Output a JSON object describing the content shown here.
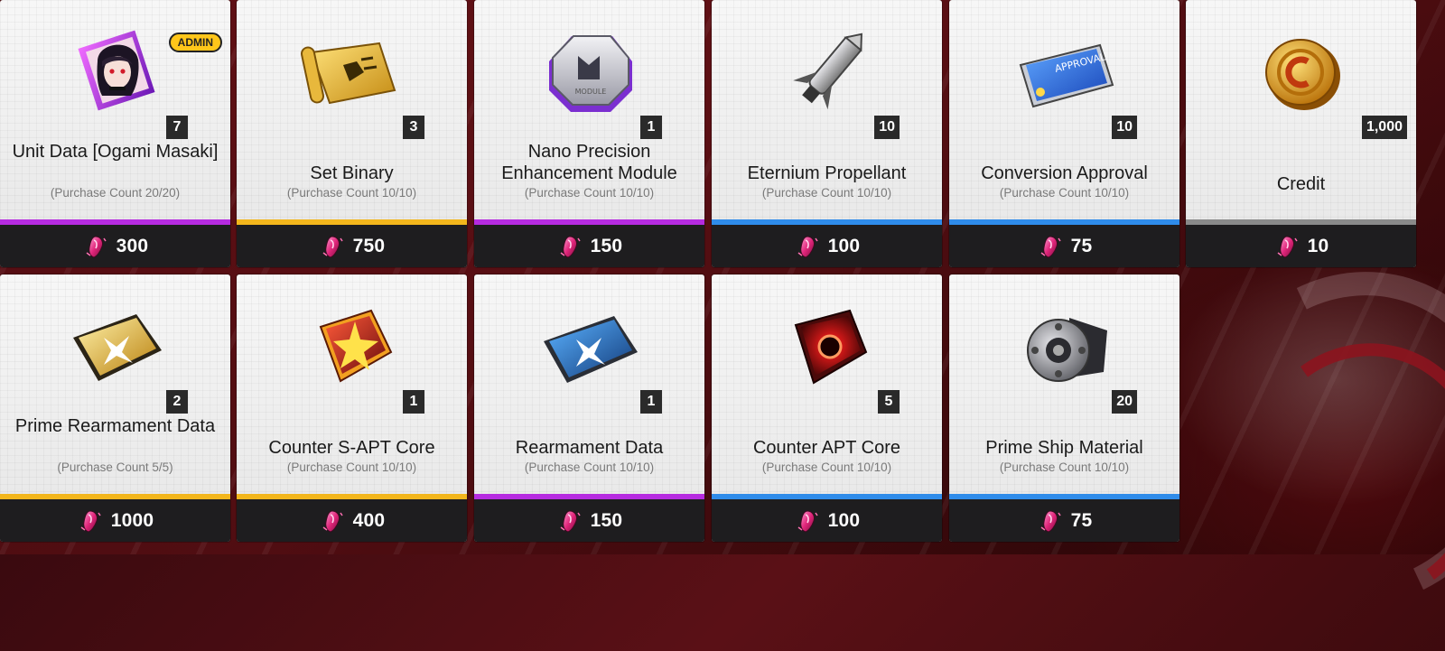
{
  "colors": {
    "purple": "#b62be0",
    "gold": "#f3b61c",
    "blue": "#2f8cea",
    "gray": "#8a8a8a"
  },
  "items": [
    {
      "name": "Unit Data [Ogami Masaki]",
      "count": "(Purchase Count 20/20)",
      "qty": "7",
      "price": "300",
      "rarity": "purple",
      "badge": "ADMIN",
      "icon": "unit-portrait-icon"
    },
    {
      "name": "Set Binary",
      "count": "(Purchase Count 10/10)",
      "qty": "3",
      "price": "750",
      "rarity": "gold",
      "icon": "scroll-icon"
    },
    {
      "name": "Nano Precision Enhancement Module",
      "count": "(Purchase Count 10/10)",
      "qty": "1",
      "price": "150",
      "rarity": "purple",
      "icon": "module-chip-icon"
    },
    {
      "name": "Eternium Propellant",
      "count": "(Purchase Count 10/10)",
      "qty": "10",
      "price": "100",
      "rarity": "blue",
      "icon": "rocket-icon"
    },
    {
      "name": "Conversion Approval",
      "count": "(Purchase Count 10/10)",
      "qty": "10",
      "price": "75",
      "rarity": "blue",
      "icon": "approval-ticket-icon"
    },
    {
      "name": "Credit",
      "count": "",
      "qty": "1,000",
      "price": "10",
      "rarity": "gray",
      "icon": "coin-icon"
    },
    {
      "name": "Prime Rearmament Data",
      "count": "(Purchase Count 5/5)",
      "qty": "2",
      "price": "1000",
      "rarity": "gold",
      "icon": "gold-data-tablet-icon"
    },
    {
      "name": "Counter S-APT Core",
      "count": "(Purchase Count 10/10)",
      "qty": "1",
      "price": "400",
      "rarity": "gold",
      "icon": "star-core-icon"
    },
    {
      "name": "Rearmament Data",
      "count": "(Purchase Count 10/10)",
      "qty": "1",
      "price": "150",
      "rarity": "purple",
      "icon": "blue-data-tablet-icon"
    },
    {
      "name": "Counter APT Core",
      "count": "(Purchase Count 10/10)",
      "qty": "5",
      "price": "100",
      "rarity": "blue",
      "icon": "red-core-icon"
    },
    {
      "name": "Prime Ship Material",
      "count": "(Purchase Count 10/10)",
      "qty": "20",
      "price": "75",
      "rarity": "blue",
      "icon": "gear-part-icon"
    }
  ]
}
